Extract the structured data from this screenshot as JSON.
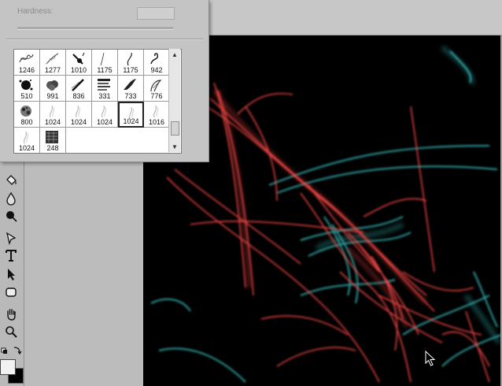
{
  "brush_panel": {
    "hardness_label": "Hardness:",
    "hardness_value": "",
    "presets": [
      {
        "size": "1246",
        "icon": "scribble-brush-icon"
      },
      {
        "size": "1277",
        "icon": "feather-brush-icon"
      },
      {
        "size": "1010",
        "icon": "splash-brush-icon"
      },
      {
        "size": "1175",
        "icon": "thin-stroke-brush-icon"
      },
      {
        "size": "1175",
        "icon": "curl-brush-icon"
      },
      {
        "size": "942",
        "icon": "swirl-brush-icon"
      },
      {
        "size": "510",
        "icon": "ink-splatter-brush-icon"
      },
      {
        "size": "991",
        "icon": "cloud-brush-icon"
      },
      {
        "size": "836",
        "icon": "streak-brush-icon"
      },
      {
        "size": "331",
        "icon": "text-texture-brush-icon"
      },
      {
        "size": "733",
        "icon": "wing-brush-icon"
      },
      {
        "size": "776",
        "icon": "plume-brush-icon"
      },
      {
        "size": "800",
        "icon": "grunge-brush-icon"
      },
      {
        "size": "1024",
        "icon": "faint-smoke-brush-icon"
      },
      {
        "size": "1024",
        "icon": "faint-smoke-brush-icon"
      },
      {
        "size": "1024",
        "icon": "faint-smoke-brush-icon"
      },
      {
        "size": "1024",
        "icon": "faint-smoke-brush-icon"
      },
      {
        "size": "1016",
        "icon": "faint-smoke-brush-icon"
      },
      {
        "size": "1024",
        "icon": "faint-smoke-brush-icon"
      },
      {
        "size": "248",
        "icon": "texture-block-brush-icon"
      }
    ],
    "selected_index": 16
  },
  "tools": [
    {
      "name": "paint-bucket-tool",
      "icon": "paint-bucket-icon"
    },
    {
      "name": "blur-tool",
      "icon": "water-drop-icon"
    },
    {
      "name": "dodge-tool",
      "icon": "dodge-icon"
    },
    {
      "name": "pen-tool",
      "icon": "pen-icon"
    },
    {
      "name": "type-tool",
      "icon": "type-icon",
      "glyph": "T"
    },
    {
      "name": "path-selection-tool",
      "icon": "arrow-select-icon"
    },
    {
      "name": "shape-tool",
      "icon": "rounded-rect-icon"
    },
    {
      "name": "hand-tool",
      "icon": "hand-icon"
    },
    {
      "name": "zoom-tool",
      "icon": "magnifier-icon"
    }
  ],
  "colors": {
    "foreground": "#f2f2f2",
    "background": "#000000",
    "canvas": "#000000",
    "stroke_red": "#ff4a4a",
    "stroke_cyan": "#3fd6d6"
  }
}
